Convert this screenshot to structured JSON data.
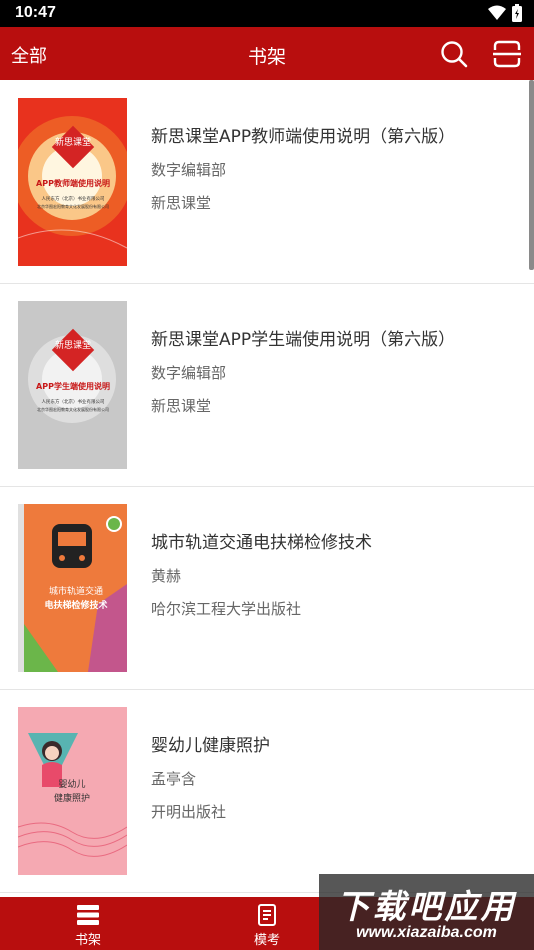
{
  "status_bar": {
    "time": "10:47"
  },
  "header": {
    "left_label": "全部",
    "title": "书架",
    "search_icon": "search-icon",
    "scan_icon": "scan-icon"
  },
  "books": [
    {
      "title": "新思课堂APP教师端使用说明（第六版）",
      "author": "数字编辑部",
      "publisher": "新思课堂",
      "cover": {
        "brand": "新思课堂",
        "heading": "APP教师端使用说明",
        "line1": "人民东方（北京）书业有限公司",
        "line2": "北京华图宏阳教育文化发展股份有限公司",
        "color": "#e8321e"
      }
    },
    {
      "title": "新思课堂APP学生端使用说明（第六版）",
      "author": "数字编辑部",
      "publisher": "新思课堂",
      "cover": {
        "brand": "新思课堂",
        "heading": "APP学生端使用说明",
        "line1": "人民东方（北京）书业有限公司",
        "line2": "北京华图宏阳教育文化发展股份有限公司",
        "color": "#c8c8c8"
      }
    },
    {
      "title": "城市轨道交通电扶梯检修技术",
      "author": "黄赫",
      "publisher": "哈尔滨工程大学出版社",
      "cover": {
        "line1": "城市轨道交通",
        "line2": "电扶梯检修技术",
        "color": "#ee7a3c"
      }
    },
    {
      "title": "婴幼儿健康照护",
      "author": "孟亭含",
      "publisher": "开明出版社",
      "cover": {
        "line1": "婴幼儿",
        "line2": "健康照护",
        "color": "#f5a9b2"
      }
    }
  ],
  "tabs": [
    {
      "label": "书架",
      "icon": "bookshelf-icon"
    },
    {
      "label": "模考",
      "icon": "exam-icon"
    }
  ],
  "watermark": {
    "line1": "下载吧应用",
    "line2": "www.xiazaiba.com"
  }
}
